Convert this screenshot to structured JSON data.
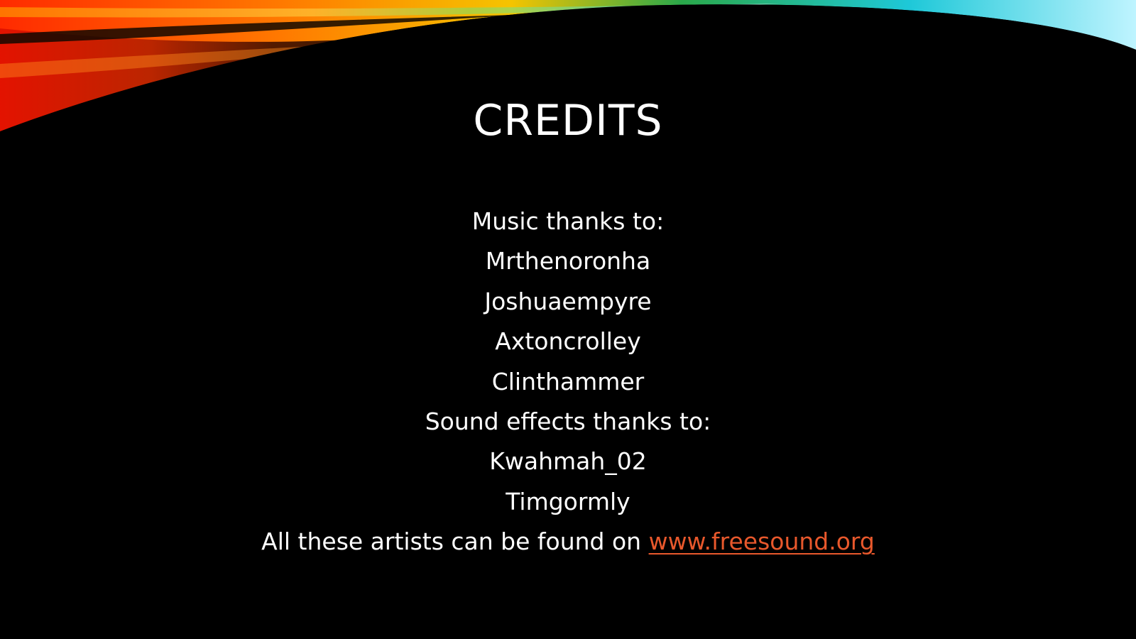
{
  "slide": {
    "title": "CREDITS",
    "lines": [
      "Music thanks to:",
      "Mrthenoronha",
      "Joshuaempyre",
      "Axtoncrolley",
      "Clinthammer",
      "Sound effects thanks to:",
      "Kwahmah_02",
      "Timgormly"
    ],
    "footer_prefix": "All these artists can be found on ",
    "footer_link": "www.freesound.org"
  },
  "colors": {
    "background": "#000000",
    "text": "#ffffff",
    "link": "#e8582c"
  }
}
